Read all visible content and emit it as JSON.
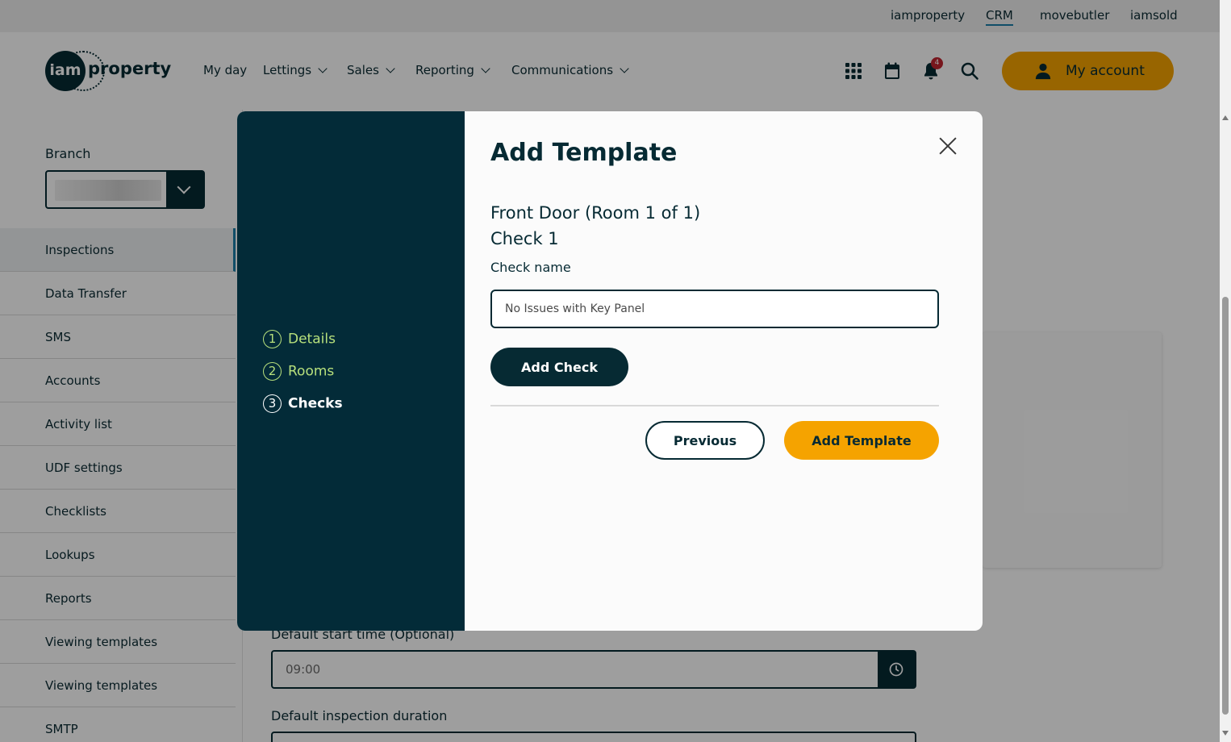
{
  "brand_links": [
    {
      "label": "iamproperty",
      "active": false
    },
    {
      "label": "CRM",
      "active": true
    },
    {
      "label": "movebutler",
      "active": false
    },
    {
      "label": "iamsold",
      "active": false
    }
  ],
  "header": {
    "logo_mark": "iam",
    "logo_text": "property",
    "nav": [
      {
        "label": "My day",
        "has_dropdown": false
      },
      {
        "label": "Lettings",
        "has_dropdown": true
      },
      {
        "label": "Sales",
        "has_dropdown": true
      },
      {
        "label": "Reporting",
        "has_dropdown": true
      },
      {
        "label": "Communications",
        "has_dropdown": true
      }
    ],
    "icons": [
      "apps-grid-icon",
      "calendar-icon",
      "bell-icon",
      "search-icon"
    ],
    "notification_count": "4",
    "account_label": "My account"
  },
  "sidebar": {
    "branch_label": "Branch",
    "items": [
      {
        "label": "Inspections",
        "active": true
      },
      {
        "label": "Data Transfer"
      },
      {
        "label": "SMS"
      },
      {
        "label": "Accounts"
      },
      {
        "label": "Activity list"
      },
      {
        "label": "UDF settings"
      },
      {
        "label": "Checklists"
      },
      {
        "label": "Lookups"
      },
      {
        "label": "Reports"
      },
      {
        "label": "Viewing templates"
      },
      {
        "label": "Viewing templates"
      },
      {
        "label": "SMTP"
      }
    ]
  },
  "background_form": {
    "start_time_label": "Default start time (Optional)",
    "start_time_value": "09:00",
    "duration_label": "Default inspection duration"
  },
  "modal": {
    "title": "Add Template",
    "steps": [
      {
        "num": "1",
        "label": "Details",
        "state": "done"
      },
      {
        "num": "2",
        "label": "Rooms",
        "state": "done"
      },
      {
        "num": "3",
        "label": "Checks",
        "state": "current"
      }
    ],
    "room_heading": "Front Door (Room 1 of 1)",
    "check_heading": "Check 1",
    "check_name_label": "Check name",
    "check_name_value": "No Issues with Key Panel",
    "add_check_label": "Add Check",
    "previous_label": "Previous",
    "add_template_label": "Add Template"
  },
  "colors": {
    "brand_dark": "#062a33",
    "modal_side": "#032b38",
    "accent": "#f5a300",
    "step_done": "#b7e07c",
    "badge": "#c0252f"
  }
}
